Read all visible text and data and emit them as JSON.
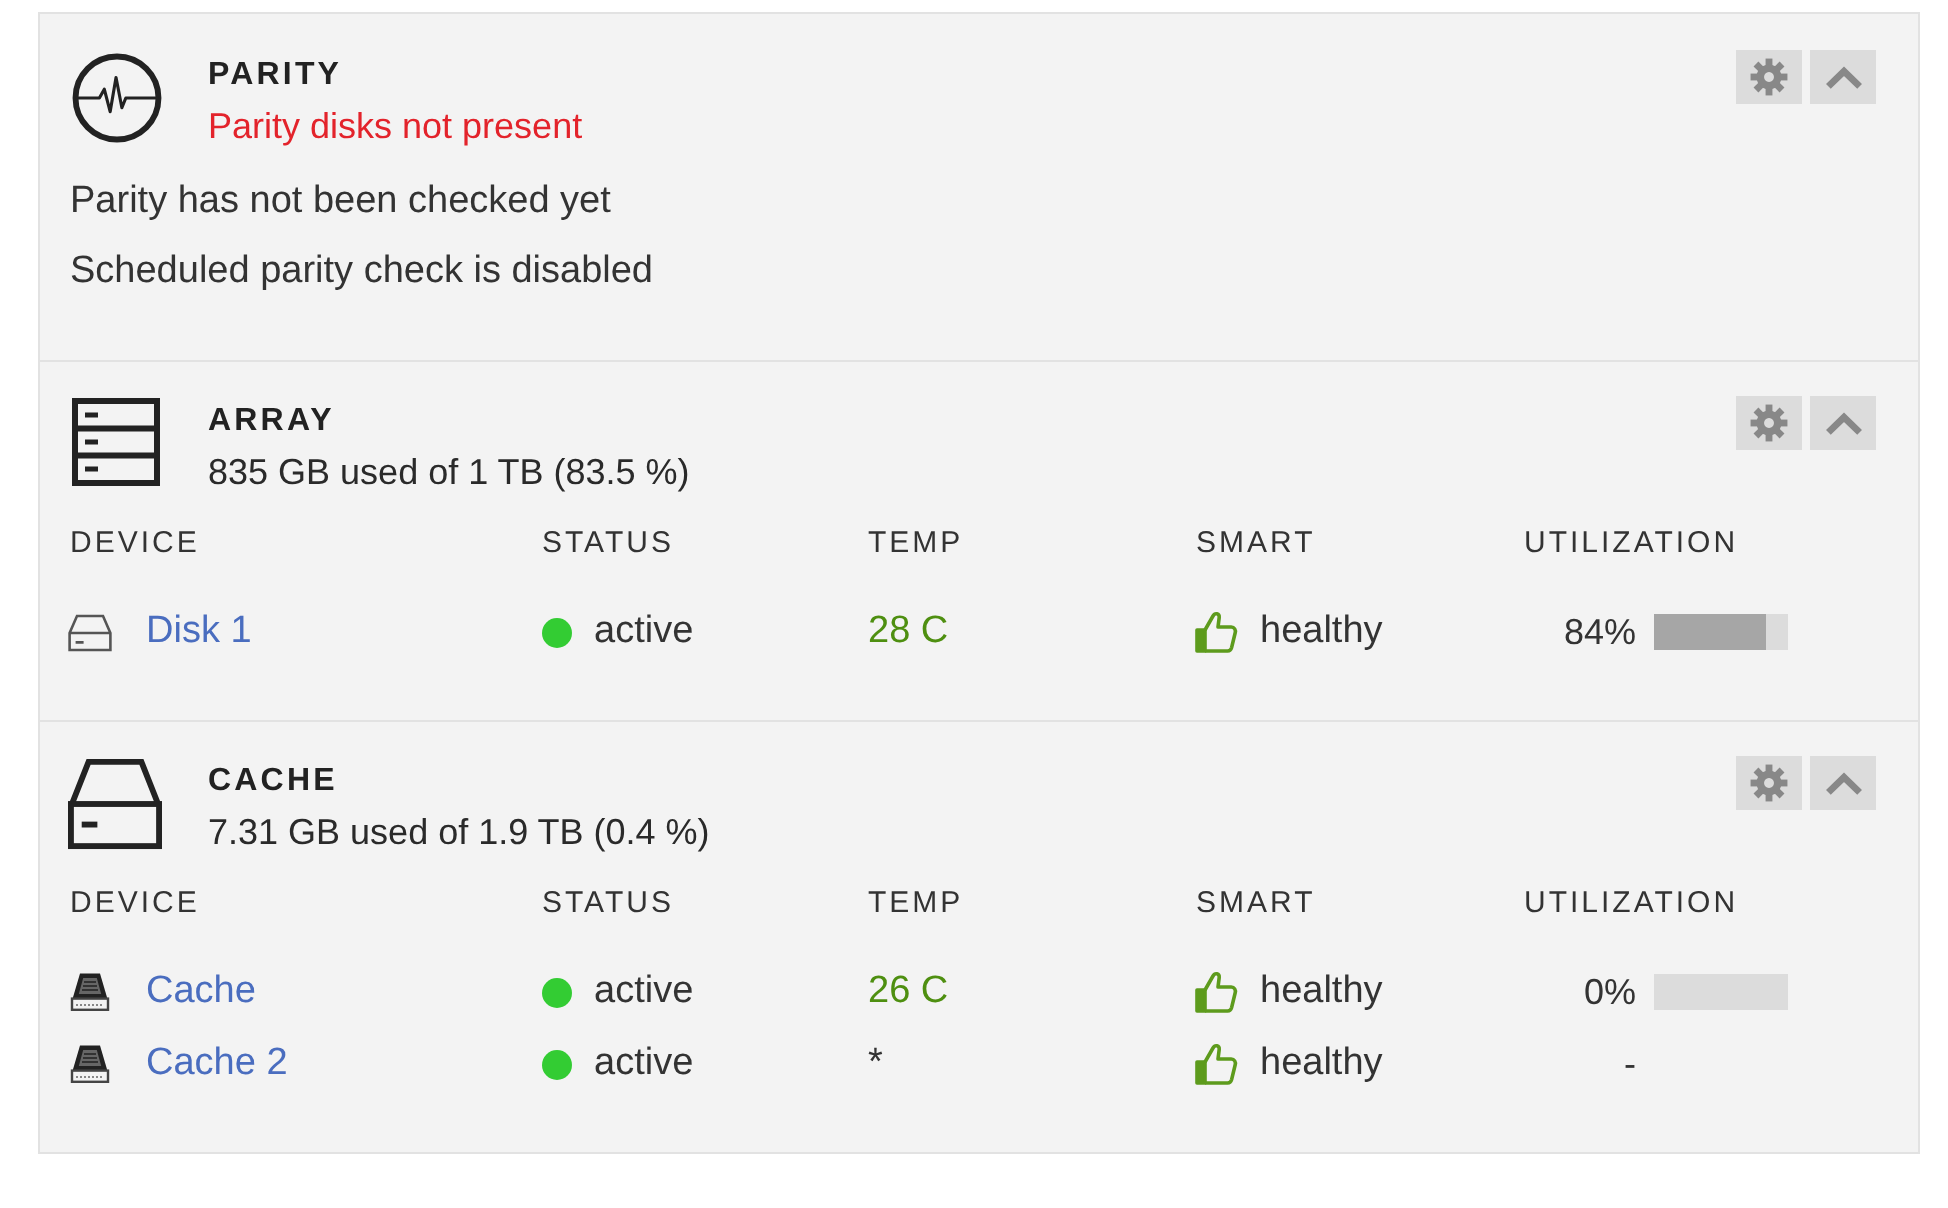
{
  "sections": [
    {
      "kind": "parity",
      "title": "PARITY",
      "subtitle": "Parity disks not present",
      "subtitle_alert": true,
      "expanded": true,
      "lines": [
        "Parity has not been checked yet",
        "Scheduled parity check is disabled"
      ]
    },
    {
      "kind": "array",
      "title": "ARRAY",
      "subtitle": "835 GB used of 1 TB (83.5 %)",
      "subtitle_alert": false,
      "expanded": true,
      "table": {
        "columns": [
          "DEVICE",
          "STATUS",
          "TEMP",
          "SMART",
          "UTILIZATION"
        ],
        "rows": [
          {
            "kind": "hdd",
            "device": "Disk 1",
            "status": "active",
            "color": "#33cc33",
            "temp": "28 C",
            "temp_normal": true,
            "smart": "healthy",
            "utilization": "84%",
            "level": 0.84
          }
        ]
      }
    },
    {
      "kind": "cache",
      "title": "CACHE",
      "subtitle": "7.31 GB used of 1.9 TB (0.4 %)",
      "subtitle_alert": false,
      "expanded": true,
      "table": {
        "columns": [
          "DEVICE",
          "STATUS",
          "TEMP",
          "SMART",
          "UTILIZATION"
        ],
        "rows": [
          {
            "kind": "ssd",
            "device": "Cache",
            "status": "active",
            "color": "#33cc33",
            "temp": "26 C",
            "temp_normal": true,
            "smart": "healthy",
            "utilization": "0%",
            "level": 0
          },
          {
            "kind": "ssd",
            "device": "Cache 2",
            "status": "active",
            "color": "#33cc33",
            "temp": "*",
            "temp_normal": false,
            "smart": "healthy",
            "utilization": "-"
          }
        ]
      }
    }
  ]
}
